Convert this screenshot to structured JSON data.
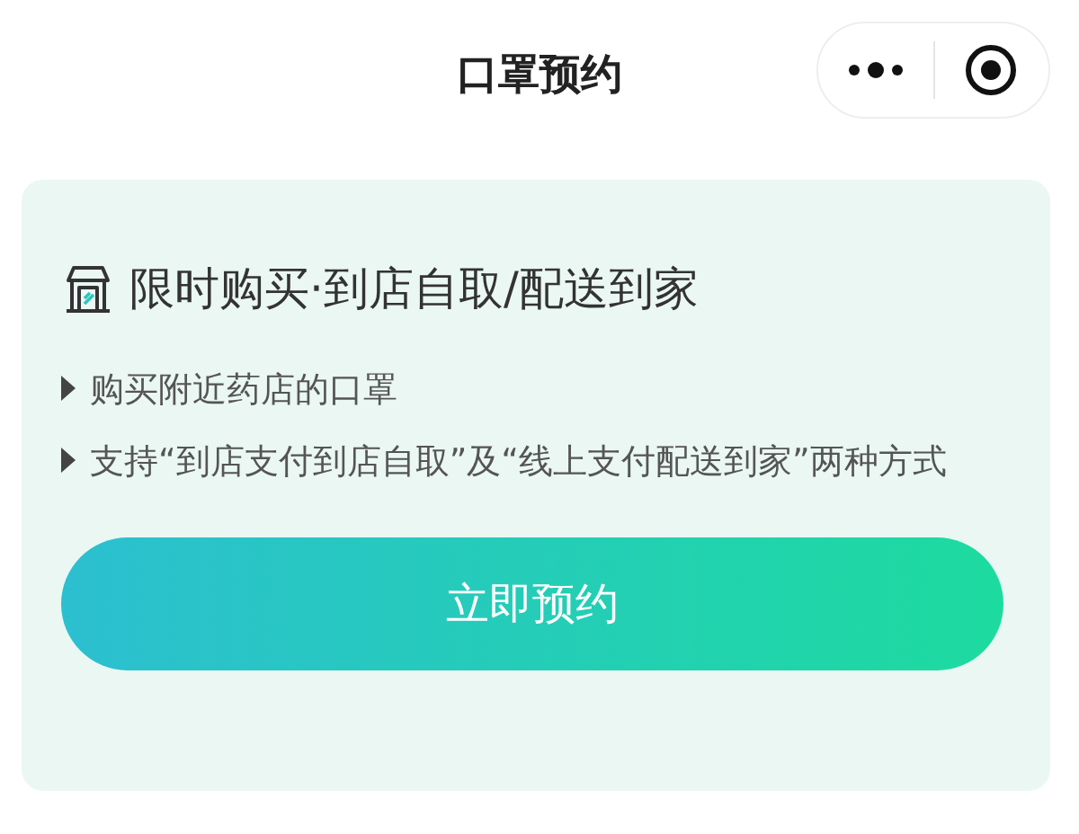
{
  "nav_bar": {
    "title": "口罩预约"
  },
  "card": {
    "title": "限时购买·到店自取/配送到家",
    "bullets": [
      "购买附近药店的口罩",
      "支持“到店支付到店自取”及“线上支付配送到家”两种方式"
    ],
    "button": "立即预约"
  }
}
